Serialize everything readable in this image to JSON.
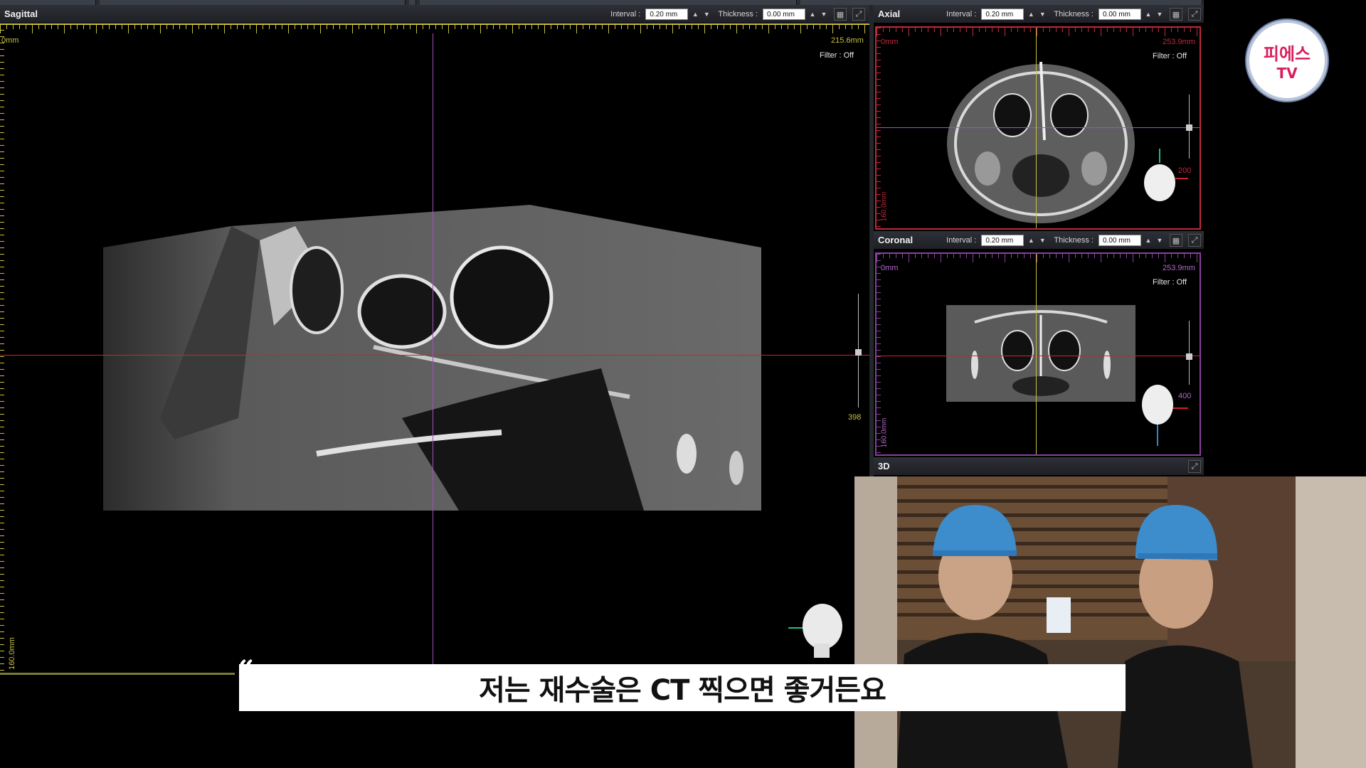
{
  "viewer": {
    "controls": {
      "interval_label": "Interval :",
      "thickness_label": "Thickness :"
    },
    "sagittal": {
      "title": "Sagittal",
      "interval": "0.20 mm",
      "thickness": "0.00 mm",
      "scale_start": "0mm",
      "scale_end": "215.6mm",
      "scale_side": "160.0mm",
      "filter": "Filter :  Off",
      "slice_number": "398"
    },
    "axial": {
      "title": "Axial",
      "interval": "0.20 mm",
      "thickness": "0.00 mm",
      "scale_start": "0mm",
      "scale_end": "253.9mm",
      "scale_side": "160.0mm",
      "filter": "Filter :  Off",
      "slice_number": "200"
    },
    "coronal": {
      "title": "Coronal",
      "interval": "0.20 mm",
      "thickness": "0.00 mm",
      "scale_start": "0mm",
      "scale_end": "253.9mm",
      "scale_side": "160.0mm",
      "filter": "Filter :  Off",
      "slice_number": "400"
    },
    "three_d": {
      "title": "3D"
    }
  },
  "overlay": {
    "subtitle": "저는 재수술은 CT 찍으면 좋거든요",
    "logo_top": "피에스",
    "logo_bottom": "TV"
  },
  "icons": [
    "grid-icon",
    "maximize-icon",
    "spin-up-icon",
    "spin-down-icon",
    "head-orientation-icon"
  ],
  "colors": {
    "axial_border": "#c0283a",
    "coronal_border": "#8a3fa0",
    "sagittal_ruler": "#c8c040",
    "crosshair_red": "#d02030",
    "crosshair_purple": "#a050c0",
    "crosshair_yellow": "#c8c040",
    "logo_pink": "#d81e5b"
  }
}
